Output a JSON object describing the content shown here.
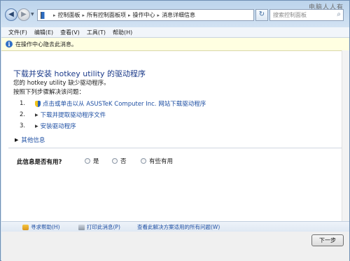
{
  "window": {
    "caption": "电脑人人有"
  },
  "address": {
    "crumbs": [
      "控制面板",
      "所有控制面板项",
      "操作中心",
      "消息详细信息"
    ]
  },
  "search": {
    "placeholder": "搜索控制面板"
  },
  "menu": [
    "文件(F)",
    "编辑(E)",
    "查看(V)",
    "工具(T)",
    "帮助(H)"
  ],
  "infobar": {
    "text": "在操作中心隐去此消息。"
  },
  "main": {
    "heading": "下载并安装  hotkey utility 的驱动程序",
    "line1": "您的  hotkey utility 缺少驱动程序。",
    "line2": "按照下列步骤解决该问题：",
    "steps": [
      {
        "num": "1.",
        "text": "点击或单击以从  ASUSTeK Computer Inc. 网站下载驱动程序"
      },
      {
        "num": "2.",
        "text": "下载并提取驱动程序文件"
      },
      {
        "num": "3.",
        "text": "安装驱动程序"
      }
    ],
    "more_info": "其他信息",
    "useful_question": "此信息是否有用?",
    "options": [
      "是",
      "否",
      "有些有用"
    ]
  },
  "footer": {
    "help": "寻求帮助(H)",
    "print": "打印此消息(P)",
    "view_all": "查看此解决方案适用的所有问题(W)"
  },
  "buttons": {
    "next": "下一步"
  }
}
